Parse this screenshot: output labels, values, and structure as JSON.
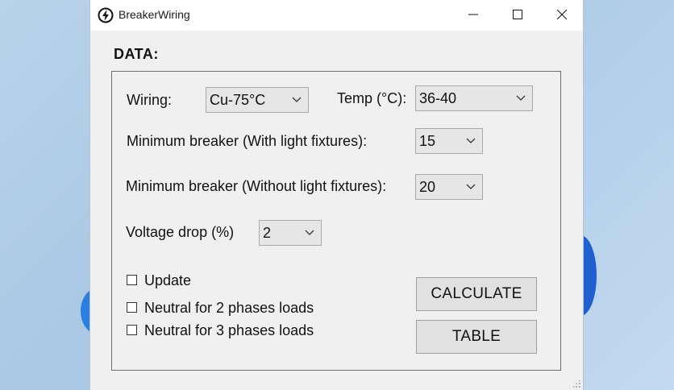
{
  "window": {
    "title": "BreakerWiring",
    "app_icon": "lightning-bolt-icon",
    "controls": [
      "minimize-icon",
      "maximize-icon",
      "close-icon"
    ]
  },
  "form": {
    "section_label": "DATA:",
    "wiring": {
      "label": "Wiring:",
      "value": "Cu-75°C"
    },
    "temp": {
      "label": "Temp (°C):",
      "value": "36-40"
    },
    "min_breaker_light": {
      "label": "Minimum breaker (With light fixtures):",
      "value": "15"
    },
    "min_breaker_no_light": {
      "label": "Minimum breaker (Without light fixtures):",
      "value": "20"
    },
    "voltage_drop": {
      "label": "Voltage drop (%)",
      "value": "2"
    },
    "checkboxes": [
      {
        "label": "Update",
        "checked": false
      },
      {
        "label": "Neutral for 2 phases loads",
        "checked": false
      },
      {
        "label": "Neutral for 3 phases loads",
        "checked": false
      }
    ],
    "calculate_label": "CALCULATE",
    "table_label": "TABLE"
  },
  "colors": {
    "window_bg": "#f0f0f0",
    "titlebar_bg": "#ffffff",
    "button_bg": "#e1e1e1",
    "desktop_accent": "#2a7fe0"
  }
}
